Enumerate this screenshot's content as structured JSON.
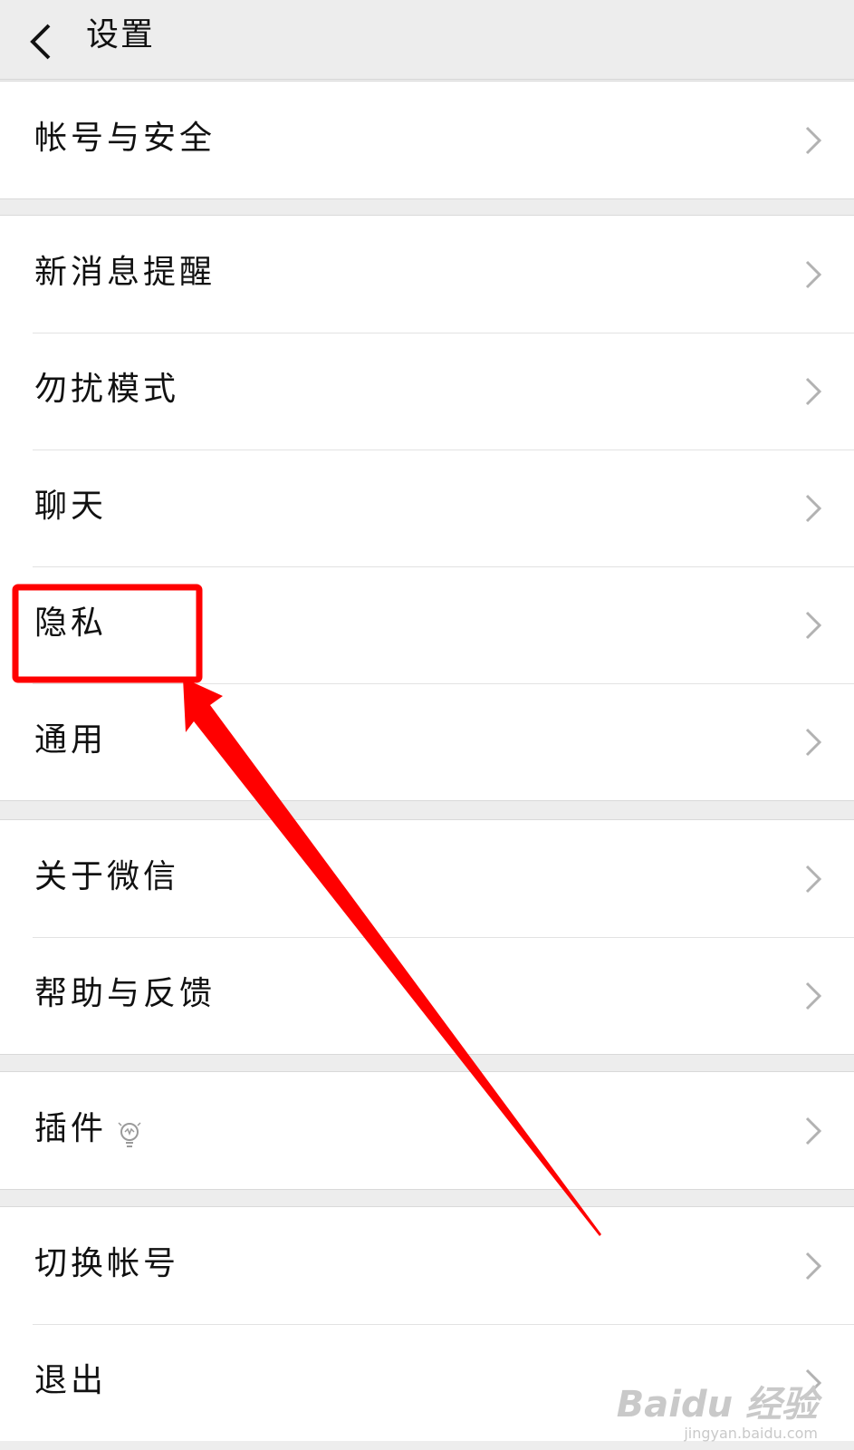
{
  "header": {
    "title": "设置"
  },
  "groups": [
    {
      "items": [
        {
          "id": "account-security",
          "label": "帐号与安全"
        }
      ]
    },
    {
      "items": [
        {
          "id": "new-message-notifications",
          "label": "新消息提醒"
        },
        {
          "id": "do-not-disturb",
          "label": "勿扰模式"
        },
        {
          "id": "chat",
          "label": "聊天"
        },
        {
          "id": "privacy",
          "label": "隐私"
        },
        {
          "id": "general",
          "label": "通用"
        }
      ]
    },
    {
      "items": [
        {
          "id": "about-wechat",
          "label": "关于微信"
        },
        {
          "id": "help-feedback",
          "label": "帮助与反馈"
        }
      ]
    },
    {
      "items": [
        {
          "id": "plugins",
          "label": "插件",
          "icon": "lightbulb-icon"
        }
      ]
    },
    {
      "items": [
        {
          "id": "switch-account",
          "label": "切换帐号"
        },
        {
          "id": "logout",
          "label": "退出"
        }
      ]
    }
  ],
  "annotation": {
    "highlighted_item": "隐私",
    "color": "#ff0000"
  },
  "watermark": {
    "brand": "Baidu 经验",
    "url": "jingyan.baidu.com"
  }
}
